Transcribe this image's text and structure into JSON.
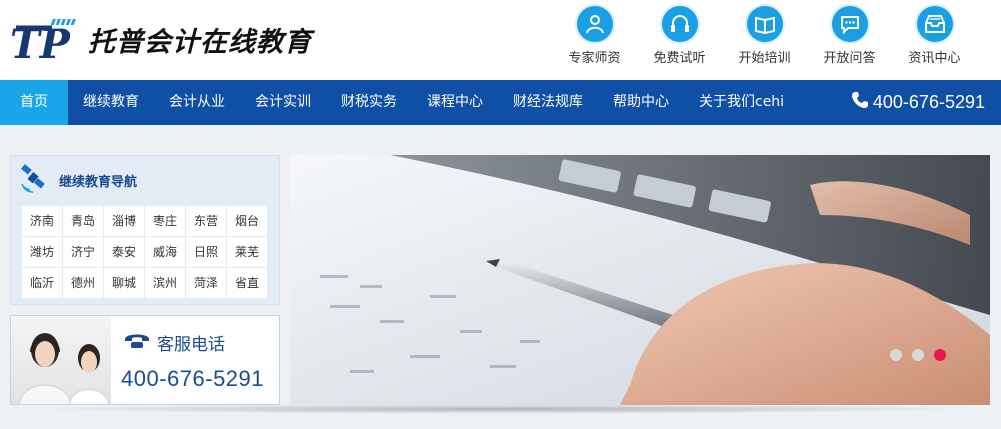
{
  "brand": {
    "logo_initials": "TP",
    "name": "托普会计在线教育"
  },
  "quick_links": [
    {
      "label": "专家师资",
      "icon": "teacher-icon"
    },
    {
      "label": "免费试听",
      "icon": "headphones-icon"
    },
    {
      "label": "开始培训",
      "icon": "book-icon"
    },
    {
      "label": "开放问答",
      "icon": "chat-icon"
    },
    {
      "label": "资讯中心",
      "icon": "inbox-icon"
    }
  ],
  "nav": {
    "items": [
      {
        "label": "首页",
        "active": true
      },
      {
        "label": "继续教育"
      },
      {
        "label": "会计从业"
      },
      {
        "label": "会计实训"
      },
      {
        "label": "财税实务"
      },
      {
        "label": "课程中心"
      },
      {
        "label": "财经法规库"
      },
      {
        "label": "帮助中心"
      },
      {
        "label": "关于我们cehi"
      }
    ],
    "phone": "400-676-5291"
  },
  "guide": {
    "title": "继续教育导航",
    "cities": [
      "济南",
      "青岛",
      "淄博",
      "枣庄",
      "东营",
      "烟台",
      "潍坊",
      "济宁",
      "泰安",
      "威海",
      "日照",
      "莱芜",
      "临沂",
      "德州",
      "聊城",
      "滨州",
      "菏泽",
      "省直"
    ]
  },
  "service": {
    "label": "客服电话",
    "number": "400-676-5291"
  },
  "banner": {
    "slide_count": 3,
    "active_slide": 3
  },
  "colors": {
    "nav_bg": "#0f4fa6",
    "nav_active": "#1aa5e8",
    "icon_blue": "#1b9fe4",
    "accent_dark": "#1a4c91",
    "dot_active": "#e8174f"
  }
}
